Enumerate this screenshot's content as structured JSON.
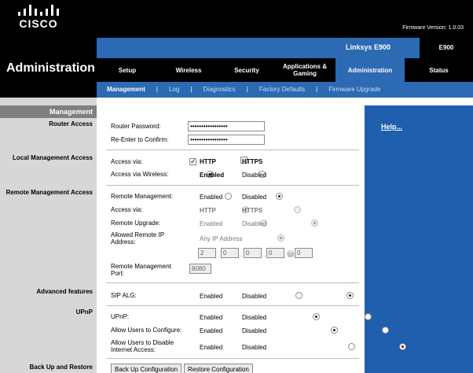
{
  "brand": {
    "logo_text": "CISCO",
    "firmware": "Firmware Version: 1.0.03"
  },
  "product": {
    "name": "Linksys E900",
    "model": "E900"
  },
  "page_title": "Administration",
  "tabs": [
    {
      "label": "Setup",
      "active": false
    },
    {
      "label": "Wireless",
      "active": false
    },
    {
      "label": "Security",
      "active": false
    },
    {
      "label": "Applications & Gaming",
      "active": false
    },
    {
      "label": "Administration",
      "active": true
    },
    {
      "label": "Status",
      "active": false
    }
  ],
  "subnav": [
    "Management",
    "Log",
    "Diagnostics",
    "Factory Defaults",
    "Firmware Upgrade"
  ],
  "section_title": "Management",
  "sections": {
    "router_access": "Router Access",
    "local_mgmt": "Local Management Access",
    "remote_mgmt": "Remote Management Access",
    "advanced": "Advanced features",
    "upnp": "UPnP",
    "backup": "Back Up and Restore"
  },
  "router_access": {
    "password_label": "Router Password:",
    "password_value": "•••••••••••••••••",
    "confirm_label": "Re-Enter to  Confirm:",
    "confirm_value": "•••••••••••••••••"
  },
  "local_access": {
    "via_label": "Access via:",
    "http": "HTTP",
    "https": "HTTPS",
    "wireless_label": "Access via Wireless:",
    "enabled": "Enabled",
    "disabled": "Disabled"
  },
  "remote_access": {
    "remote_label": "Remote  Management:",
    "enabled": "Enabled",
    "disabled": "Disabled",
    "via_label": "Access via:",
    "http": "HTTP",
    "https": "HTTPS",
    "upgrade_label": "Remote Upgrade:",
    "allowed_label": "Allowed Remote IP Address:",
    "any_ip": "Any IP Address",
    "ip": [
      "2",
      "0",
      "0",
      "0"
    ],
    "to_label": "to",
    "ip_end": "0",
    "port_label": "Remote Management Port:",
    "port_value": "8080"
  },
  "advanced": {
    "sip_label": "SIP ALG:",
    "enabled": "Enabled",
    "disabled": "Disabled"
  },
  "upnp": {
    "upnp_label": "UPnP:",
    "configure_label": "Allow Users to Configure:",
    "disable_label": "Allow Users to Disable Internet Access:",
    "enabled": "Enabled",
    "disabled": "Disabled"
  },
  "backup": {
    "backup_button": "Back Up Configuration",
    "restore_button": "Restore Configuration"
  },
  "help": {
    "link": "Help..."
  }
}
